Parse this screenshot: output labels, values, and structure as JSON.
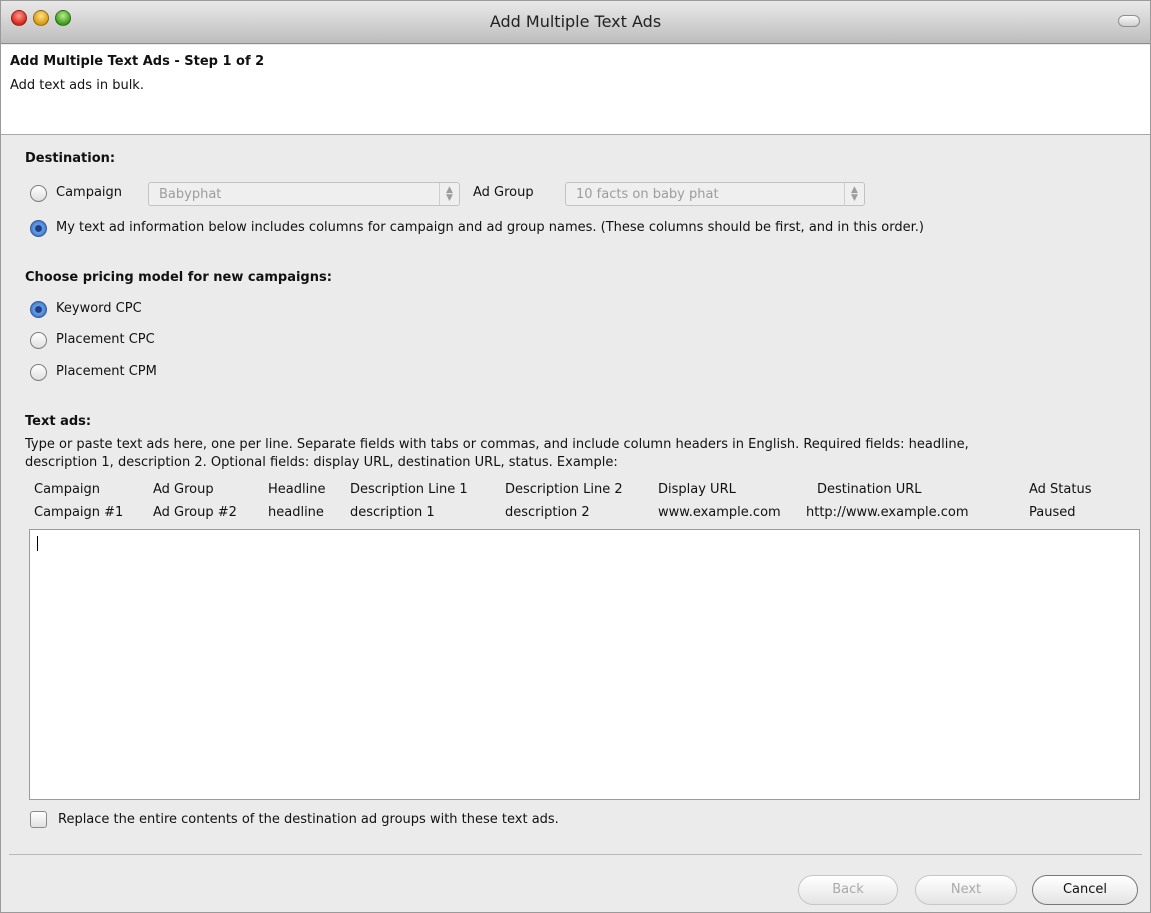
{
  "window": {
    "title": "Add Multiple Text Ads"
  },
  "header": {
    "step_title": "Add Multiple Text Ads - Step 1 of 2",
    "subtitle": "Add text ads in bulk."
  },
  "destination": {
    "label": "Destination:",
    "campaign_option": "Campaign",
    "campaign_value": "Babyphat",
    "ad_group_label": "Ad Group",
    "ad_group_value": "10 facts on baby phat",
    "columns_option": "My text ad information below includes columns for campaign and ad group names. (These columns should be first, and in this order.)",
    "selected": "columns_option"
  },
  "pricing": {
    "label": "Choose pricing model for new campaigns:",
    "options": [
      "Keyword CPC",
      "Placement CPC",
      "Placement CPM"
    ],
    "selected": "Keyword CPC"
  },
  "text_ads": {
    "label": "Text ads:",
    "instructions_line1": "Type or paste text ads here, one per line. Separate fields with tabs or commas, and include column headers in English. Required fields: headline,",
    "instructions_line2": "description 1, description 2. Optional fields: display URL, destination URL, status. Example:",
    "example_headers": [
      "Campaign",
      "Ad Group",
      "Headline",
      "Description Line 1",
      "Description Line 2",
      "Display URL",
      "Destination URL",
      "Ad Status"
    ],
    "example_row": [
      "Campaign #1",
      "Ad Group #2",
      "headline",
      "description 1",
      "description 2",
      "www.example.com",
      "http://www.example.com",
      "Paused"
    ],
    "input_value": ""
  },
  "replace_checkbox": {
    "label": "Replace the entire contents of the destination ad groups with these text ads.",
    "checked": false
  },
  "buttons": {
    "back": "Back",
    "next": "Next",
    "cancel": "Cancel"
  },
  "colors": {
    "radio_selected": "#2f6dc6",
    "window_bg": "#ebebeb"
  }
}
